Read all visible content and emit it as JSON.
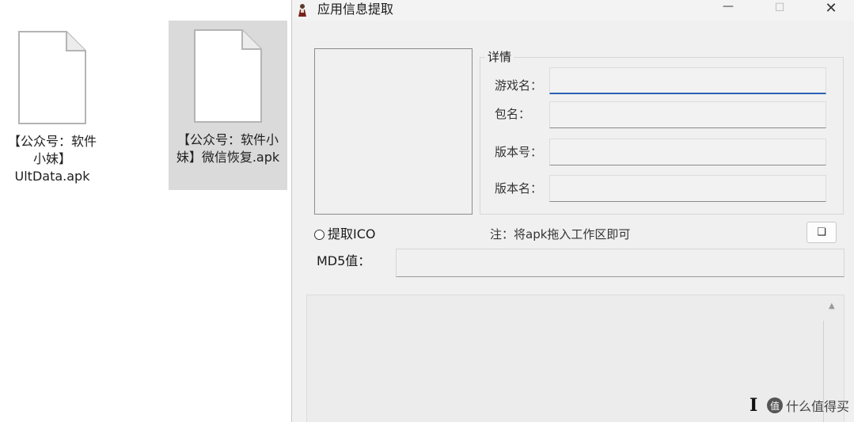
{
  "desktop": {
    "files": [
      {
        "name": "【公众号：软件小妹】UltData.apk"
      },
      {
        "name": "【公众号：软件小妹】微信恢复.apk"
      }
    ]
  },
  "window": {
    "title": "应用信息提取",
    "controls": {
      "minimize": "—",
      "maximize": "☐",
      "close": "✕"
    }
  },
  "details": {
    "legend": "详情",
    "fields": [
      {
        "label": "游戏名：",
        "value": ""
      },
      {
        "label": "包名：",
        "value": ""
      },
      {
        "label": "版本号：",
        "value": ""
      },
      {
        "label": "版本名：",
        "value": ""
      }
    ]
  },
  "options": {
    "extract_ico": "提取ICO",
    "note": "注：将apk拖入工作区即可",
    "small_button": "❏"
  },
  "md5": {
    "label": "MD5值：",
    "value": ""
  },
  "log": {
    "value": "",
    "scroll_up": "▲"
  },
  "watermark": {
    "icon": "值",
    "text": "什么值得买"
  },
  "cursor": {
    "glyph": "I"
  },
  "colors": {
    "accent": "#2a62b4",
    "window_bg": "#f0f0f0",
    "selected_file": "#dadada"
  }
}
